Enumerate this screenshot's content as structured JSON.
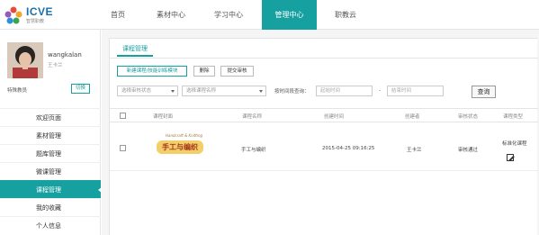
{
  "logo": {
    "brand": "ICVE",
    "sub": "智慧职教"
  },
  "nav": {
    "items": [
      {
        "label": "首页"
      },
      {
        "label": "素材中心"
      },
      {
        "label": "学习中心"
      },
      {
        "label": "管理中心",
        "active": true
      },
      {
        "label": "职教云"
      }
    ]
  },
  "user": {
    "name": "wangkalan",
    "real_name": "王卡兰",
    "role": "特殊教员",
    "switch_label": "切换"
  },
  "sidebar": {
    "items": [
      {
        "label": "欢迎页面"
      },
      {
        "label": "素材管理"
      },
      {
        "label": "题库管理"
      },
      {
        "label": "微课管理"
      },
      {
        "label": "课程管理",
        "active": true
      },
      {
        "label": "我的收藏"
      },
      {
        "label": "个人信息"
      }
    ]
  },
  "main": {
    "tab": "课程管理",
    "buttons": {
      "new": "新建课程/技能训练模块",
      "delete": "删除",
      "submit": "提交审核"
    },
    "filters": {
      "status_placeholder": "选择审核状态",
      "course_placeholder": "选择课程名称",
      "time_label": "按时间段查询：",
      "start_placeholder": "起始时间",
      "end_placeholder": "结束时间",
      "dash": "-",
      "query": "查询"
    },
    "table": {
      "headers": [
        "课程封面",
        "课程名称",
        "创建时间",
        "创建者",
        "审核状态",
        "课程类型"
      ],
      "rows": [
        {
          "cover_small": "Handcraft & Knitting",
          "cover_big": "手工与编织",
          "name": "手工与编织",
          "created": "2015-04-25 09:16:25",
          "creator": "王卡兰",
          "status": "审核通过",
          "type": "标准化课程"
        }
      ]
    }
  },
  "colors": {
    "accent": "#17a0a0"
  }
}
